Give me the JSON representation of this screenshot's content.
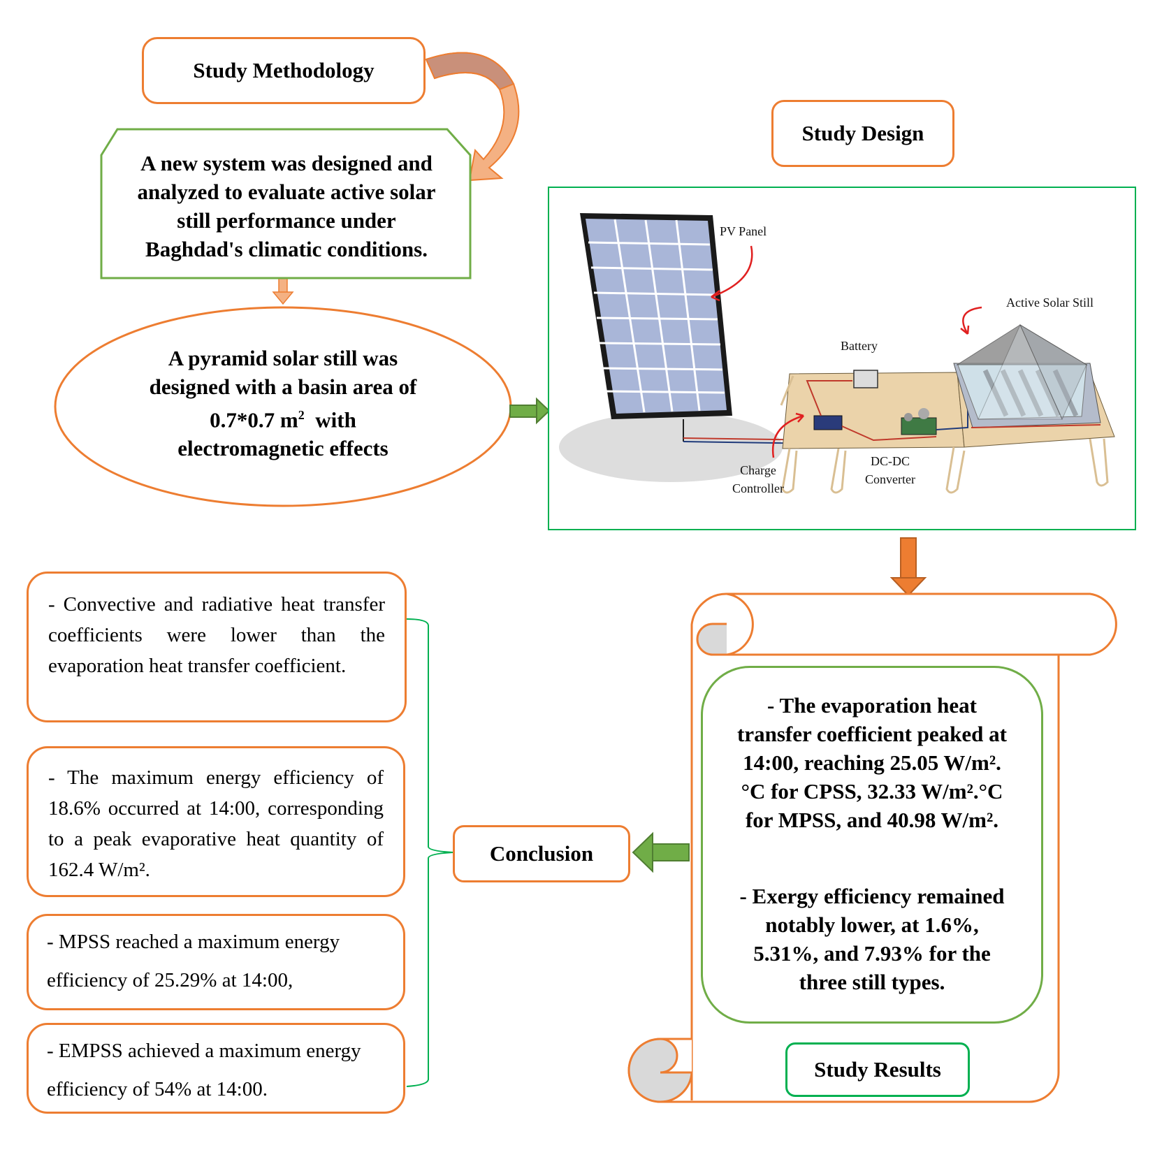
{
  "colors": {
    "orange": "#ED7D31",
    "light_orange": "#F4B183",
    "green_border": "#70AD47",
    "bright_green": "#00B050",
    "green_arrow": "#70AD47",
    "text": "#000000"
  },
  "methodology": {
    "title": "Study Methodology",
    "system_text": "A new system was designed and analyzed to evaluate active solar still performance under Baghdad's climatic conditions.",
    "pyramid_lines": [
      "A pyramid solar still was",
      "designed with a basin area of"
    ],
    "pyramid_dim_prefix": "0.7*0.7 m",
    "pyramid_dim_sup": "2",
    "pyramid_dim_suffix": "  with",
    "pyramid_last_line": "electromagnetic effects"
  },
  "design": {
    "title": "Study Design",
    "figure_labels": {
      "pv_panel": "PV Panel",
      "active_solar_still": "Active Solar Still",
      "battery": "Battery",
      "charge_controller_1": "Charge",
      "charge_controller_2": "Controller",
      "dcdc_1": "DC-DC",
      "dcdc_2": "Converter"
    }
  },
  "results": {
    "title": "Study Results",
    "paragraph1": "- The evaporation heat transfer coefficient peaked at 14:00, reaching 25.05 W/m².°C for CPSS, 32.33 W/m².°C for MPSS, and 40.98 W/m².",
    "paragraph2": "- Exergy efficiency remained notably lower, at 1.6%, 5.31%, and 7.93% for the three still types."
  },
  "conclusion": {
    "title": "Conclusion",
    "items": [
      "- Convective and radiative heat transfer coefficients were lower than the evaporation heat transfer coefficient.",
      "- The maximum energy efficiency of 18.6% occurred at 14:00, corresponding to a peak evaporative heat quantity of 162.4 W/m².",
      "- MPSS reached a maximum energy efficiency of 25.29% at 14:00,",
      "- EMPSS achieved a maximum energy efficiency of 54% at 14:00."
    ]
  }
}
